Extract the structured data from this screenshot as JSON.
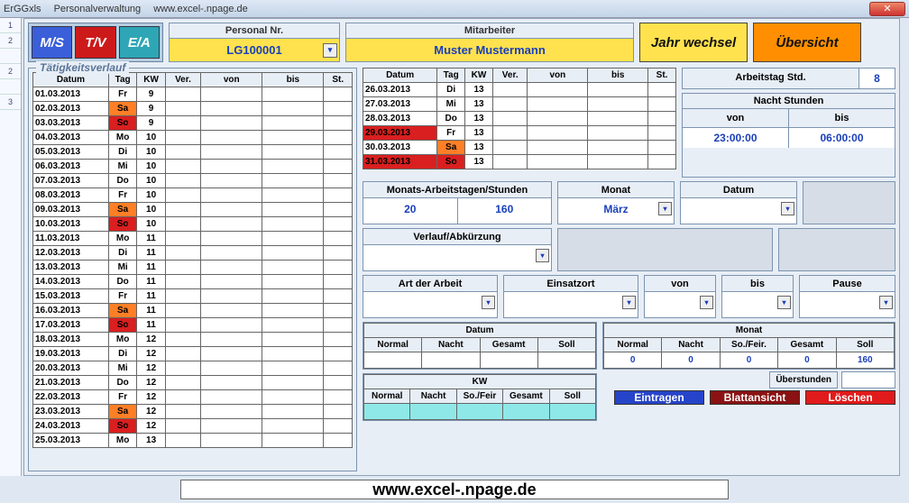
{
  "titlebar": {
    "app": "ErGGxls",
    "mod": "Personalverwaltung",
    "url": "www.excel-.npage.de"
  },
  "mode": {
    "ms": "M/S",
    "tv": "T/V",
    "ea": "E/A"
  },
  "header": {
    "personalnr_label": "Personal Nr.",
    "personalnr_value": "LG100001",
    "mitarbeiter_label": "Mitarbeiter",
    "mitarbeiter_value": "Muster Mustermann",
    "jahr_btn": "Jahr wechsel",
    "uebersicht_btn": "Übersicht"
  },
  "section_title": "Tätigkeitsverlauf",
  "table_headers": {
    "datum": "Datum",
    "tag": "Tag",
    "kw": "KW",
    "ver": "Ver.",
    "von": "von",
    "bis": "bis",
    "st": "St."
  },
  "left_rows": [
    {
      "d": "01.03.2013",
      "t": "Fr",
      "k": "9"
    },
    {
      "d": "02.03.2013",
      "t": "Sa",
      "k": "9",
      "c": "sa"
    },
    {
      "d": "03.03.2013",
      "t": "So",
      "k": "9",
      "c": "so"
    },
    {
      "d": "04.03.2013",
      "t": "Mo",
      "k": "10"
    },
    {
      "d": "05.03.2013",
      "t": "Di",
      "k": "10"
    },
    {
      "d": "06.03.2013",
      "t": "Mi",
      "k": "10"
    },
    {
      "d": "07.03.2013",
      "t": "Do",
      "k": "10"
    },
    {
      "d": "08.03.2013",
      "t": "Fr",
      "k": "10"
    },
    {
      "d": "09.03.2013",
      "t": "Sa",
      "k": "10",
      "c": "sa"
    },
    {
      "d": "10.03.2013",
      "t": "So",
      "k": "10",
      "c": "so"
    },
    {
      "d": "11.03.2013",
      "t": "Mo",
      "k": "11"
    },
    {
      "d": "12.03.2013",
      "t": "Di",
      "k": "11"
    },
    {
      "d": "13.03.2013",
      "t": "Mi",
      "k": "11"
    },
    {
      "d": "14.03.2013",
      "t": "Do",
      "k": "11"
    },
    {
      "d": "15.03.2013",
      "t": "Fr",
      "k": "11"
    },
    {
      "d": "16.03.2013",
      "t": "Sa",
      "k": "11",
      "c": "sa"
    },
    {
      "d": "17.03.2013",
      "t": "So",
      "k": "11",
      "c": "so"
    },
    {
      "d": "18.03.2013",
      "t": "Mo",
      "k": "12"
    },
    {
      "d": "19.03.2013",
      "t": "Di",
      "k": "12"
    },
    {
      "d": "20.03.2013",
      "t": "Mi",
      "k": "12"
    },
    {
      "d": "21.03.2013",
      "t": "Do",
      "k": "12"
    },
    {
      "d": "22.03.2013",
      "t": "Fr",
      "k": "12"
    },
    {
      "d": "23.03.2013",
      "t": "Sa",
      "k": "12",
      "c": "sa"
    },
    {
      "d": "24.03.2013",
      "t": "So",
      "k": "12",
      "c": "so"
    },
    {
      "d": "25.03.2013",
      "t": "Mo",
      "k": "13"
    }
  ],
  "right_rows": [
    {
      "d": "26.03.2013",
      "t": "Di",
      "k": "13"
    },
    {
      "d": "27.03.2013",
      "t": "Mi",
      "k": "13"
    },
    {
      "d": "28.03.2013",
      "t": "Do",
      "k": "13"
    },
    {
      "d": "29.03.2013",
      "t": "Fr",
      "k": "13",
      "dc": "red"
    },
    {
      "d": "30.03.2013",
      "t": "Sa",
      "k": "13",
      "c": "sa"
    },
    {
      "d": "31.03.2013",
      "t": "So",
      "k": "13",
      "c": "so",
      "dc": "red"
    }
  ],
  "stats": {
    "arbeitstag_label": "Arbeitstag Std.",
    "arbeitstag_val": "8",
    "nacht_title": "Nacht Stunden",
    "nacht_von_h": "von",
    "nacht_bis_h": "bis",
    "nacht_von": "23:00:00",
    "nacht_bis": "06:00:00"
  },
  "row2": {
    "mas_label": "Monats-Arbeitstagen/Stunden",
    "mas_v1": "20",
    "mas_v2": "160",
    "monat_label": "Monat",
    "monat_val": "März",
    "datum_label": "Datum"
  },
  "row3": {
    "verlauf_label": "Verlauf/Abkürzung"
  },
  "row4": {
    "art_label": "Art der Arbeit",
    "einsatz_label": "Einsatzort",
    "von": "von",
    "bis": "bis",
    "pause": "Pause"
  },
  "sum_datum": {
    "title": "Datum",
    "h": [
      "Normal",
      "Nacht",
      "Gesamt",
      "Soll"
    ]
  },
  "sum_kw": {
    "title": "KW",
    "h": [
      "Normal",
      "Nacht",
      "So./Feir",
      "Gesamt",
      "Soll"
    ]
  },
  "sum_monat": {
    "title": "Monat",
    "h": [
      "Normal",
      "Nacht",
      "So./Feir.",
      "Gesamt",
      "Soll"
    ],
    "v": [
      "0",
      "0",
      "0",
      "0",
      "160"
    ],
    "ueber_label": "Überstunden"
  },
  "actions": {
    "eintragen": "Eintragen",
    "blatt": "Blattansicht",
    "loeschen": "Löschen"
  },
  "footer": "www.excel-.npage.de"
}
